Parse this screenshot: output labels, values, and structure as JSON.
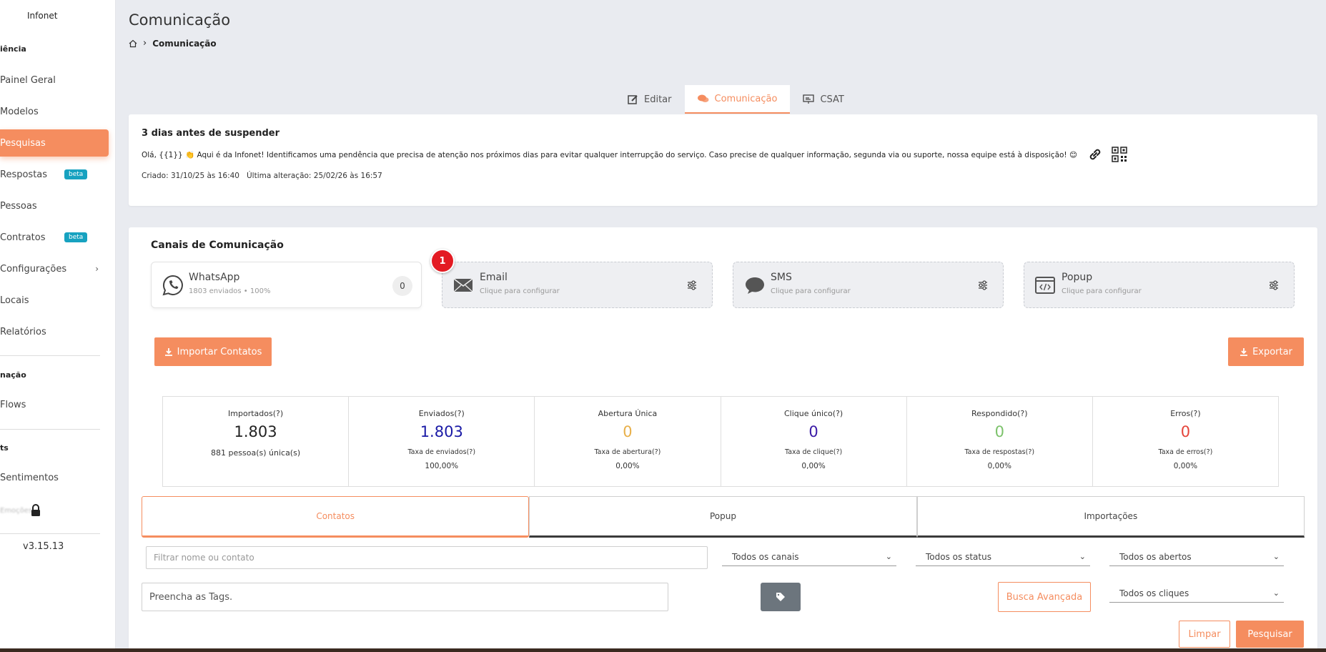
{
  "sidebar": {
    "brand": "Infonet",
    "section1": "iência",
    "items": [
      {
        "label": "Painel Geral"
      },
      {
        "label": "Modelos"
      },
      {
        "label": "Pesquisas"
      },
      {
        "label": "Respostas",
        "badge": "beta"
      },
      {
        "label": "Pessoas"
      },
      {
        "label": "Contratos",
        "badge": "beta"
      },
      {
        "label": "Configurações"
      },
      {
        "label": "Locais"
      },
      {
        "label": "Relatórios"
      }
    ],
    "section2": "nação",
    "section2_items": [
      {
        "label": "Flows"
      }
    ],
    "section3": "ts",
    "section3_items": [
      {
        "label": "Sentimentos"
      },
      {
        "label": "Emoções"
      }
    ],
    "version": "v3.15.13"
  },
  "header": {
    "title": "Comunicação",
    "breadcrumb_current": "Comunicação"
  },
  "top_tabs": [
    {
      "label": "Editar"
    },
    {
      "label": "Comunicação"
    },
    {
      "label": "CSAT"
    }
  ],
  "message": {
    "title": "3 dias antes de suspender",
    "body": "Olá, {{1}} 👏 Aqui é da Infonet! Identificamos uma pendência que precisa de atenção nos próximos dias para evitar qualquer interrupção do serviço. Caso precise de qualquer informação, segunda via ou suporte, nossa equipe está à disposição! 😊",
    "meta": "Criado: 31/10/25 às 16:40   Última alteração: 25/02/26 às 16:57"
  },
  "channels": {
    "title": "Canais de Comunicação",
    "notification_count": "1",
    "items": [
      {
        "name": "WhatsApp",
        "sub": "1803 enviados • 100%",
        "count": "0"
      },
      {
        "name": "Email",
        "sub": "Clique para configurar"
      },
      {
        "name": "SMS",
        "sub": "Clique para configurar"
      },
      {
        "name": "Popup",
        "sub": "Clique para configurar"
      }
    ]
  },
  "actions": {
    "import_label": "Importar Contatos",
    "export_label": "Exportar"
  },
  "stats": [
    {
      "label": "Importados(?)",
      "value": "1.803",
      "sub": "881 pessoa(s) única(s)",
      "color": "#222222"
    },
    {
      "label": "Enviados(?)",
      "value": "1.803",
      "sub": "Taxa de enviados(?)",
      "rate": "100,00%",
      "color": "#1a1aa6"
    },
    {
      "label": "Abertura Única",
      "value": "0",
      "sub": "Taxa de abertura(?)",
      "rate": "0,00%",
      "color": "#e8b04a"
    },
    {
      "label": "Clique único(?)",
      "value": "0",
      "sub": "Taxa de clique(?)",
      "rate": "0,00%",
      "color": "#3a1aa6"
    },
    {
      "label": "Respondido(?)",
      "value": "0",
      "sub": "Taxa de respostas(?)",
      "rate": "0,00%",
      "color": "#7cc26b"
    },
    {
      "label": "Erros(?)",
      "value": "0",
      "sub": "Taxa de erros(?)",
      "rate": "0,00%",
      "color": "#e5443a"
    }
  ],
  "lower_tabs": [
    {
      "label": "Contatos"
    },
    {
      "label": "Popup"
    },
    {
      "label": "Importações"
    }
  ],
  "filters": {
    "search_placeholder": "Filtrar nome ou contato",
    "channels": "Todos os canais",
    "status": "Todos os status",
    "opened": "Todos os abertos",
    "tags_placeholder": "Preencha as Tags.",
    "advanced": "Busca Avançada",
    "clicks": "Todos os cliques",
    "clear": "Limpar",
    "search": "Pesquisar"
  },
  "colors": {
    "accent": "#f58d5f",
    "badge": "#17a2c0",
    "notification": "#e31b23"
  }
}
